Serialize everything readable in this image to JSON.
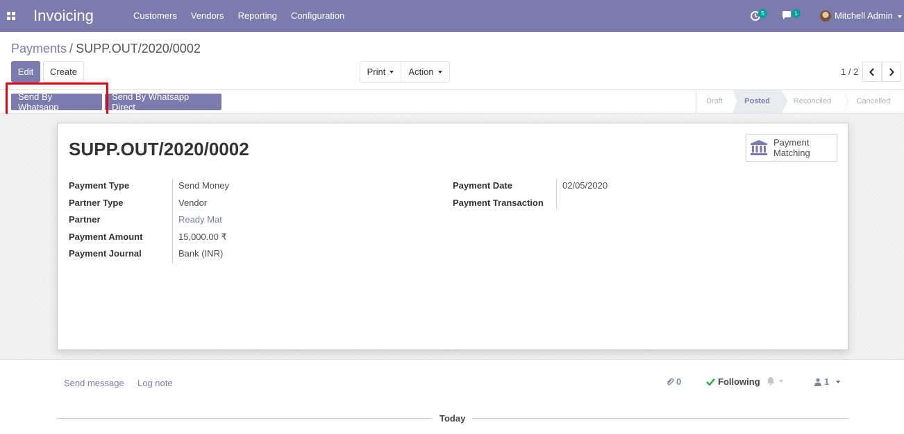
{
  "navbar": {
    "app_title": "Invoicing",
    "menu": [
      "Customers",
      "Vendors",
      "Reporting",
      "Configuration"
    ],
    "activity_count": "5",
    "message_count": "1",
    "user_name": "Mitchell Admin"
  },
  "breadcrumb": {
    "parent": "Payments",
    "separator": "/",
    "current": "SUPP.OUT/2020/0002"
  },
  "buttons": {
    "edit": "Edit",
    "create": "Create",
    "print": "Print",
    "action": "Action",
    "send_whatsapp": "Send By Whatsapp",
    "send_whatsapp_direct": "Send By Whatsapp Direct"
  },
  "pager": {
    "value": "1 / 2"
  },
  "stages": [
    "Draft",
    "Posted",
    "Reconciled",
    "Cancelled"
  ],
  "current_stage": "Posted",
  "form": {
    "title": "SUPP.OUT/2020/0002",
    "smart_button": {
      "line1": "Payment",
      "line2": "Matching",
      "icon": "bank-icon"
    },
    "left_fields": [
      {
        "label": "Payment Type",
        "value": "Send Money"
      },
      {
        "label": "Partner Type",
        "value": "Vendor"
      },
      {
        "label": "Partner",
        "value": "Ready Mat"
      },
      {
        "label": "Payment Amount",
        "value": "15,000.00 ₹"
      },
      {
        "label": "Payment Journal",
        "value": "Bank (INR)"
      }
    ],
    "right_fields": [
      {
        "label": "Payment Date",
        "value": "02/05/2020"
      },
      {
        "label": "Payment Transaction",
        "value": ""
      }
    ]
  },
  "chatter": {
    "send_message": "Send message",
    "log_note": "Log note",
    "attachments": "0",
    "following": "Following",
    "followers": "1",
    "today": "Today"
  },
  "colors": {
    "brand": "#7c7bad",
    "highlight": "#e4000f",
    "following_check": "#28a745"
  }
}
